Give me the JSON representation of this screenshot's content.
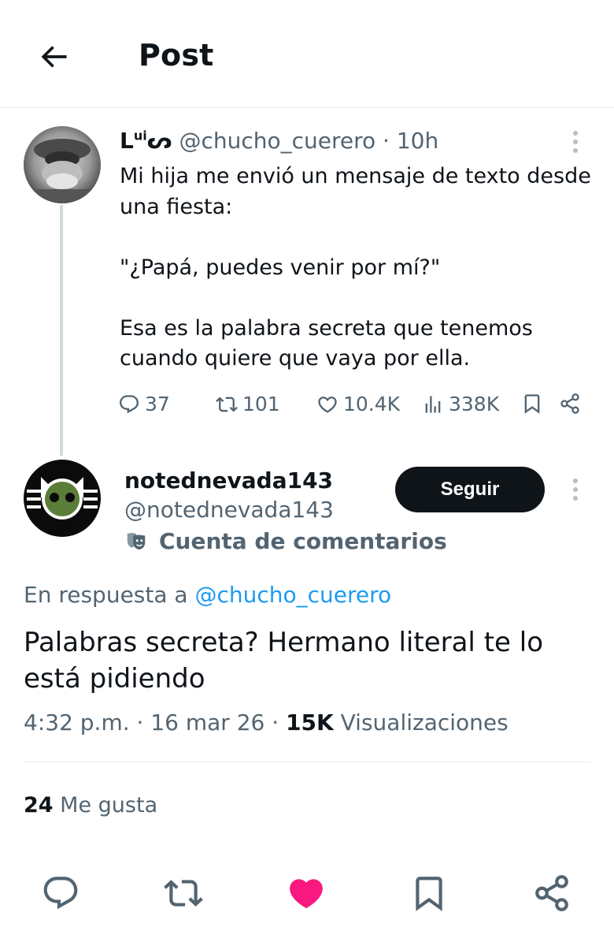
{
  "header": {
    "title": "Post",
    "back_icon": "arrow-left-icon"
  },
  "parent_tweet": {
    "display_name": "L",
    "display_name_sup": "ui",
    "display_name_suffix": "ᔕ",
    "handle": "@chucho_cuerero",
    "separator": " · ",
    "time": "10h",
    "text": "Mi hija me envió un mensaje de texto desde una fiesta:\n\n\"¿Papá, puedes venir por mí?\"\n\nEsa es la palabra secreta que tenemos cuando quiere que vaya por ella.",
    "stats": {
      "replies": "37",
      "reposts": "101",
      "likes": "10.4K",
      "views": "338K"
    }
  },
  "reply_tweet": {
    "display_name": "notednevada143",
    "handle": "@notednevada143",
    "follow_label": "Seguir",
    "badge_label": "Cuenta de comentarios",
    "reply_prefix": "En respuesta a ",
    "reply_mention": "@chucho_cuerero",
    "text": "Palabras secreta? Hermano literal te lo está pidiendo",
    "time": "4:32 p.m.",
    "date": "16 mar 26",
    "views_count": "15K",
    "views_label": "Visualizaciones",
    "dot": " · ",
    "likes_count": "24",
    "likes_label": "Me gusta"
  },
  "colors": {
    "accent": "#1d9bf0",
    "like_active": "#f91880",
    "text_primary": "#0f1419",
    "text_secondary": "#536471",
    "divider": "#e6ecf0"
  }
}
